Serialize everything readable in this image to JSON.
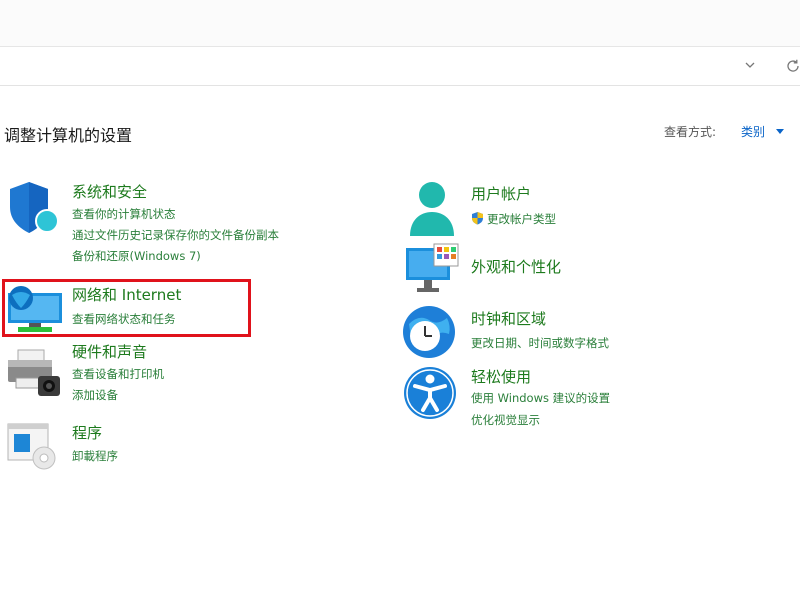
{
  "page": {
    "title": "调整计算机的设置"
  },
  "view": {
    "label": "查看方式:",
    "value": "类别"
  },
  "categories": {
    "security": {
      "title": "系统和安全",
      "links": [
        "查看你的计算机状态",
        "通过文件历史记录保存你的文件备份副本",
        "备份和还原(Windows 7)"
      ]
    },
    "network": {
      "title": "网络和 Internet",
      "links": [
        "查看网络状态和任务"
      ]
    },
    "hardware": {
      "title": "硬件和声音",
      "links": [
        "查看设备和打印机",
        "添加设备"
      ]
    },
    "programs": {
      "title": "程序",
      "links": [
        "卸載程序"
      ]
    },
    "accounts": {
      "title": "用户帐户",
      "links": [
        "更改帐户类型"
      ]
    },
    "appearance": {
      "title": "外观和个性化",
      "links": []
    },
    "clock": {
      "title": "时钟和区域",
      "links": [
        "更改日期、时间或数字格式"
      ]
    },
    "ease": {
      "title": "轻松使用",
      "links": [
        "使用 Windows 建议的设置",
        "优化视觉显示"
      ]
    }
  },
  "colors": {
    "link_green": "#2a7f3a",
    "title_green": "#1d7a1d",
    "accent_blue": "#0a64c8",
    "highlight_red": "#e0121b"
  }
}
